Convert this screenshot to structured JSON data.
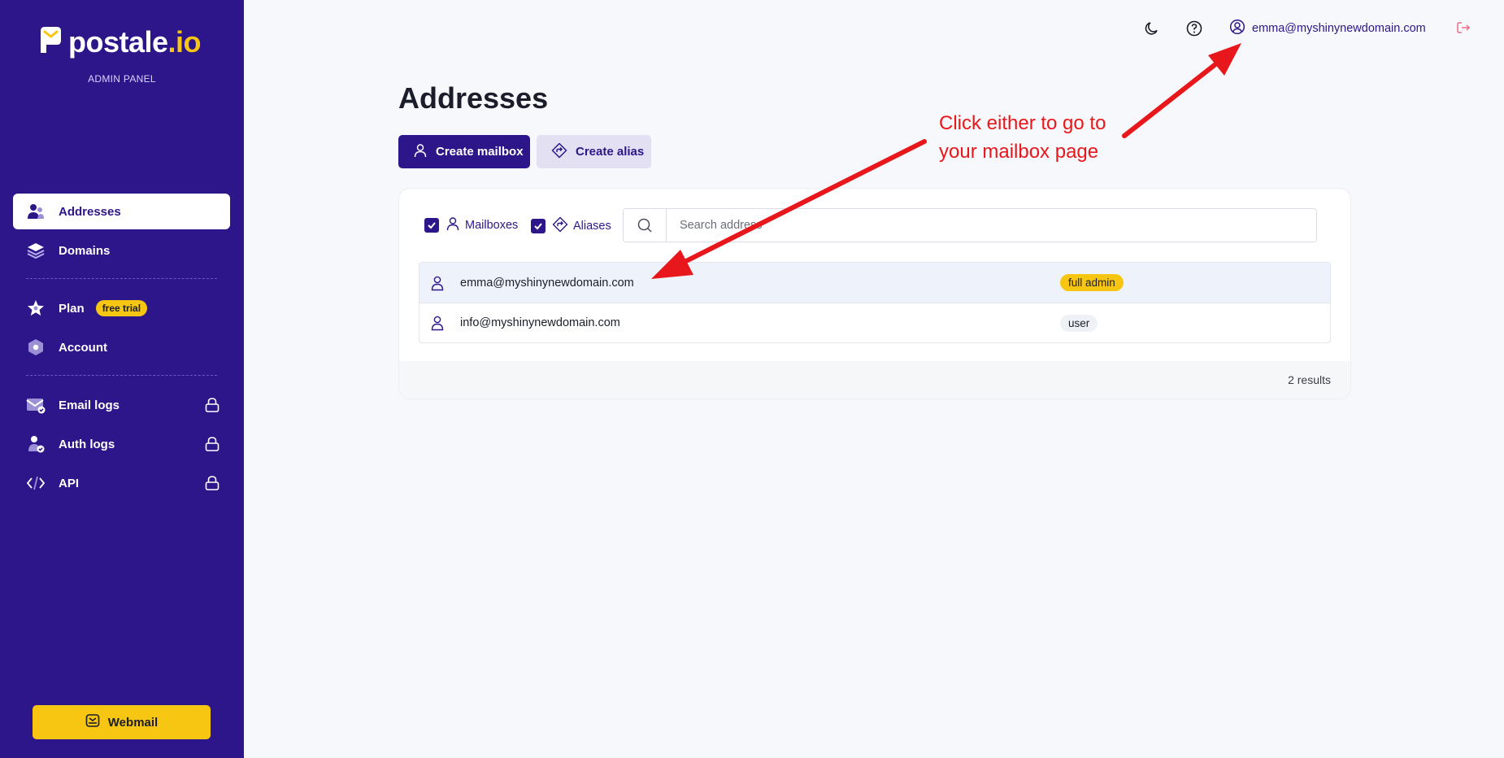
{
  "brand": {
    "name_main": "postale",
    "name_accent": ".io",
    "subtitle": "ADMIN PANEL"
  },
  "sidebar": {
    "items": [
      {
        "label": "Addresses",
        "icon": "users-icon",
        "active": true
      },
      {
        "label": "Domains",
        "icon": "layers-icon"
      },
      {
        "label": "Plan",
        "icon": "star-icon",
        "badge": "free trial"
      },
      {
        "label": "Account",
        "icon": "hexagon-icon"
      },
      {
        "label": "Email logs",
        "icon": "mail-check-icon",
        "locked": true
      },
      {
        "label": "Auth logs",
        "icon": "user-check-icon",
        "locked": true
      },
      {
        "label": "API",
        "icon": "code-icon",
        "locked": true
      }
    ],
    "webmail_label": "Webmail"
  },
  "topbar": {
    "user_email": "emma@myshinynewdomain.com"
  },
  "page": {
    "title": "Addresses",
    "create_mailbox_label": "Create mailbox",
    "create_alias_label": "Create alias"
  },
  "filters": {
    "mailboxes_label": "Mailboxes",
    "aliases_label": "Aliases",
    "mailboxes_checked": true,
    "aliases_checked": true
  },
  "search": {
    "placeholder": "Search address"
  },
  "addresses": [
    {
      "email": "emma@myshinynewdomain.com",
      "role": "full admin"
    },
    {
      "email": "info@myshinynewdomain.com",
      "role": "user"
    }
  ],
  "results_text": "2 results",
  "annotation": {
    "line1": "Click either to go to",
    "line2": "your mailbox page"
  },
  "colors": {
    "primary": "#2d168a",
    "accent": "#f6c612",
    "annotation": "#e8171b",
    "background": "#f7f8fb"
  }
}
